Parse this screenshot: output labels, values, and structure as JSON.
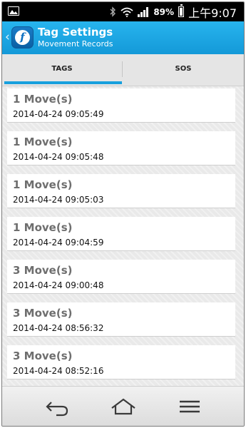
{
  "status_bar": {
    "battery_percent": "89%",
    "time": "上午9:07",
    "icons": [
      "gallery-icon",
      "bluetooth-icon",
      "wifi-icon",
      "signal-icon",
      "battery-icon"
    ]
  },
  "app_bar": {
    "title": "Tag Settings",
    "subtitle": "Movement Records",
    "logo_icon": "app-logo-icon",
    "accent_color": "#1499d8"
  },
  "tabs": [
    {
      "label": "TAGS",
      "selected": true
    },
    {
      "label": "SOS",
      "selected": false
    }
  ],
  "records": [
    {
      "count": "1 Move(s)",
      "timestamp": "2014-04-24 09:05:49"
    },
    {
      "count": "1 Move(s)",
      "timestamp": "2014-04-24 09:05:48"
    },
    {
      "count": "1 Move(s)",
      "timestamp": "2014-04-24 09:05:03"
    },
    {
      "count": "1 Move(s)",
      "timestamp": "2014-04-24 09:04:59"
    },
    {
      "count": "3 Move(s)",
      "timestamp": "2014-04-24 09:00:48"
    },
    {
      "count": "3 Move(s)",
      "timestamp": "2014-04-24 08:56:32"
    },
    {
      "count": "3 Move(s)",
      "timestamp": "2014-04-24 08:52:16"
    }
  ],
  "nav_bar": {
    "buttons": [
      "back-icon",
      "home-icon",
      "menu-icon"
    ]
  }
}
